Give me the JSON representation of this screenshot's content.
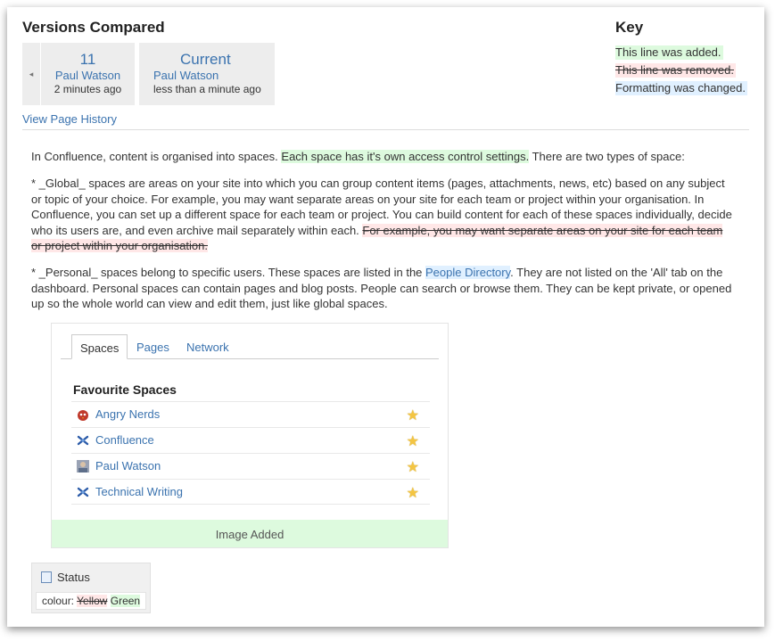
{
  "header": {
    "title": "Versions Compared"
  },
  "versions": {
    "nav_arrow": "◂",
    "old": {
      "number": "11",
      "author": "Paul Watson",
      "time": "2 minutes ago"
    },
    "current": {
      "number": "Current",
      "author": "Paul Watson",
      "time": "less than a minute ago"
    }
  },
  "key": {
    "title": "Key",
    "added": "This line was added.",
    "removed": "This line was removed.",
    "changed": "Formatting was changed."
  },
  "links": {
    "history": "View Page History"
  },
  "content": {
    "p1_a": "In Confluence, content is organised into spaces. ",
    "p1_added": "Each space has it's own access control settings.",
    "p1_b": " There are two types of space:",
    "p2_a": "* _Global_ spaces are areas on your site into which you can group content items (pages, attachments, news, etc) based on any subject or topic of your choice. For example, you may want separate areas on your site for each team or project within your organisation. In Confluence, you can set up a different space for each team or project. You can build content for each of these spaces individually, decide who its users are, and even archive mail separately within each. ",
    "p2_removed": "For example, you may want separate areas on your site for each team or project within your organisation.",
    "p3_a": "* _Personal_ spaces belong to specific users. These spaces are listed in the ",
    "p3_link": "People Directory",
    "p3_b": ". They are not listed on the 'All' tab on the dashboard. Personal spaces can contain pages and blog posts. People can search or browse them. They can be kept private, or opened up so the whole world can view and edit them, just like global spaces."
  },
  "macro": {
    "tabs": [
      "Spaces",
      "Pages",
      "Network"
    ],
    "fav_title": "Favourite Spaces",
    "spaces": [
      {
        "label": "Angry Nerds",
        "icon": "angry-bird-icon"
      },
      {
        "label": "Confluence",
        "icon": "confluence-icon"
      },
      {
        "label": "Paul Watson",
        "icon": "user-avatar-icon"
      },
      {
        "label": "Technical Writing",
        "icon": "confluence-icon"
      }
    ],
    "image_added": "Image Added"
  },
  "status": {
    "title": "Status",
    "colour_label": "colour:",
    "old_value": "Yellow",
    "new_value": "Green"
  },
  "colors": {
    "link": "#3b73af",
    "added_bg": "#ddfade",
    "removed_bg": "#ffe7e7",
    "changed_bg": "#e0f0ff",
    "star": "#f4c542"
  }
}
